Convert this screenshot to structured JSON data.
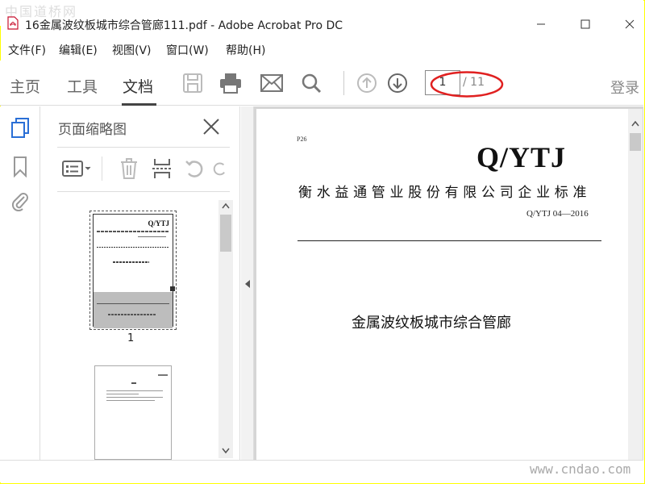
{
  "watermark": {
    "top": "中国道桥网",
    "bottom": "www.cndao.com"
  },
  "window": {
    "title": "16金属波纹板城市综合管廊111.pdf - Adobe Acrobat Pro DC"
  },
  "menu": [
    "文件(F)",
    "编辑(E)",
    "视图(V)",
    "窗口(W)",
    "帮助(H)"
  ],
  "toolbar": {
    "tabs": [
      {
        "label": "主页",
        "active": false
      },
      {
        "label": "工具",
        "active": false
      },
      {
        "label": "文档",
        "active": true
      }
    ],
    "page_current": "1",
    "page_total": "/ 11",
    "login": "登录",
    "highlight_color": "#e02020"
  },
  "thumbnails": {
    "title": "页面缩略图",
    "items": [
      {
        "label": "1"
      }
    ]
  },
  "document": {
    "page_no": "P26",
    "standard": "Q/YTJ",
    "company": "衡水益通管业股份有限公司企业标准",
    "code": "Q/YTJ 04—2016",
    "heading": "金属波纹板城市综合管廊"
  },
  "colors": {
    "accent": "#2a6fd6",
    "frame": "#ffff00"
  }
}
